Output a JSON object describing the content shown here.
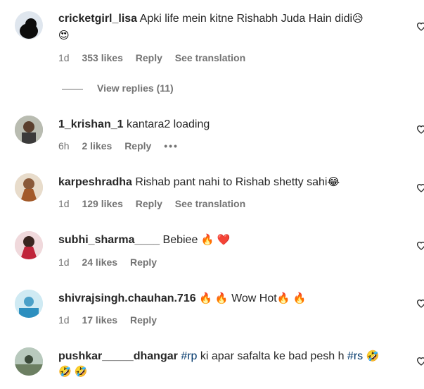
{
  "comments": [
    {
      "username": "cricketgirl_lisa",
      "text": "Apki life mein kitne Rishabh Juda Hain didi",
      "emoji_inline": "😥",
      "emoji_line2": "😍",
      "time": "1d",
      "likes": "353 likes",
      "reply": "Reply",
      "translate": "See translation"
    },
    {
      "username": "1_krishan_1",
      "text": "kantara2 loading",
      "time": "6h",
      "likes": "2 likes",
      "reply": "Reply",
      "more": "•••"
    },
    {
      "username": "karpeshradha",
      "text": "Rishab pant nahi to Rishab shetty sahi",
      "emoji_inline": "😂",
      "time": "1d",
      "likes": "129 likes",
      "reply": "Reply",
      "translate": "See translation"
    },
    {
      "username": "subhi_sharma____",
      "text": "Bebiee",
      "emoji_inline": "🔥 ❤️",
      "time": "1d",
      "likes": "24 likes",
      "reply": "Reply"
    },
    {
      "username": "shivrajsingh.chauhan.716",
      "text_pre": "🔥 🔥",
      "text": "Wow Hot",
      "text_post": "🔥 🔥",
      "time": "1d",
      "likes": "17 likes",
      "reply": "Reply"
    },
    {
      "username": "pushkar_____dhangar",
      "tag1": "#rp",
      "text": "ki apar safalta ke bad pesh h",
      "tag2": "#rs",
      "emoji_inline": "🤣",
      "emoji_line2": "🤣 🤣"
    }
  ],
  "view_replies": "View replies (11)",
  "icons": {
    "like": "heart-outline-icon"
  }
}
